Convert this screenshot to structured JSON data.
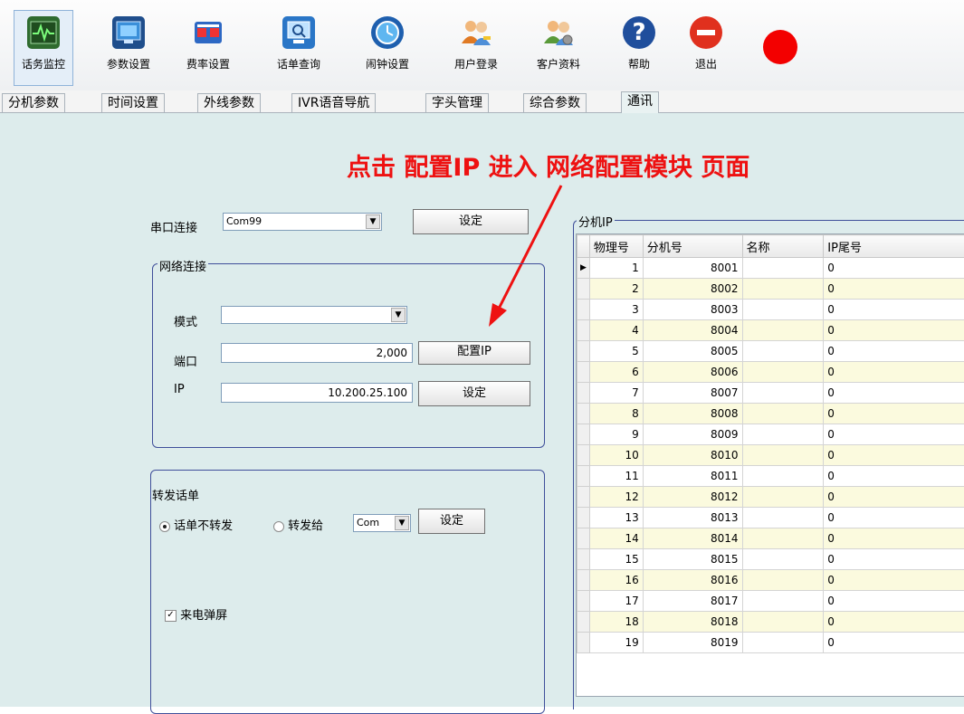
{
  "toolbar": {
    "buttons": [
      {
        "label": "话务监控",
        "icon": "monitor-pulse-icon"
      },
      {
        "label": "参数设置",
        "icon": "settings-screen-icon"
      },
      {
        "label": "费率设置",
        "icon": "rate-icon"
      },
      {
        "label": "话单查询",
        "icon": "query-screen-icon"
      },
      {
        "label": "闹钟设置",
        "icon": "alarm-clock-icon"
      },
      {
        "label": "用户登录",
        "icon": "user-login-icon"
      },
      {
        "label": "客户资料",
        "icon": "customer-data-icon"
      },
      {
        "label": "帮助",
        "icon": "help-icon"
      },
      {
        "label": "退出",
        "icon": "exit-icon"
      }
    ],
    "record_icon": "record-dot-icon"
  },
  "tabs": [
    {
      "label": "分机参数"
    },
    {
      "label": "时间设置"
    },
    {
      "label": "外线参数"
    },
    {
      "label": "IVR语音导航"
    },
    {
      "label": "字头管理"
    },
    {
      "label": "综合参数"
    },
    {
      "label": "通讯"
    }
  ],
  "annotation": "点击 配置IP 进入 网络配置模块 页面",
  "serial": {
    "label": "串口连接",
    "value": "Com99",
    "button": "设定"
  },
  "network": {
    "title": "网络连接",
    "mode_label": "模式",
    "mode_value": "",
    "port_label": "端口",
    "port_value": "2,000",
    "config_ip_button": "配置IP",
    "ip_label": "IP",
    "ip_value": "10.200.25.100",
    "set_button": "设定"
  },
  "forward": {
    "title": "转发话单",
    "option_no": "话单不转发",
    "option_to": "转发给",
    "target_value": "Com",
    "button": "设定",
    "popup_label": "来电弹屏"
  },
  "ip_table": {
    "title": "分机IP",
    "columns": [
      "物理号",
      "分机号",
      "名称",
      "IP尾号"
    ],
    "rows": [
      [
        "1",
        "8001",
        "",
        "0"
      ],
      [
        "2",
        "8002",
        "",
        "0"
      ],
      [
        "3",
        "8003",
        "",
        "0"
      ],
      [
        "4",
        "8004",
        "",
        "0"
      ],
      [
        "5",
        "8005",
        "",
        "0"
      ],
      [
        "6",
        "8006",
        "",
        "0"
      ],
      [
        "7",
        "8007",
        "",
        "0"
      ],
      [
        "8",
        "8008",
        "",
        "0"
      ],
      [
        "9",
        "8009",
        "",
        "0"
      ],
      [
        "10",
        "8010",
        "",
        "0"
      ],
      [
        "11",
        "8011",
        "",
        "0"
      ],
      [
        "12",
        "8012",
        "",
        "0"
      ],
      [
        "13",
        "8013",
        "",
        "0"
      ],
      [
        "14",
        "8014",
        "",
        "0"
      ],
      [
        "15",
        "8015",
        "",
        "0"
      ],
      [
        "16",
        "8016",
        "",
        "0"
      ],
      [
        "17",
        "8017",
        "",
        "0"
      ],
      [
        "18",
        "8018",
        "",
        "0"
      ],
      [
        "19",
        "8019",
        "",
        "0"
      ]
    ]
  },
  "colors": {
    "annotation": "#ee1111",
    "panel_bg": "#ddecec",
    "row_alt": "#fbfade",
    "group_border": "#3f4f9a"
  }
}
